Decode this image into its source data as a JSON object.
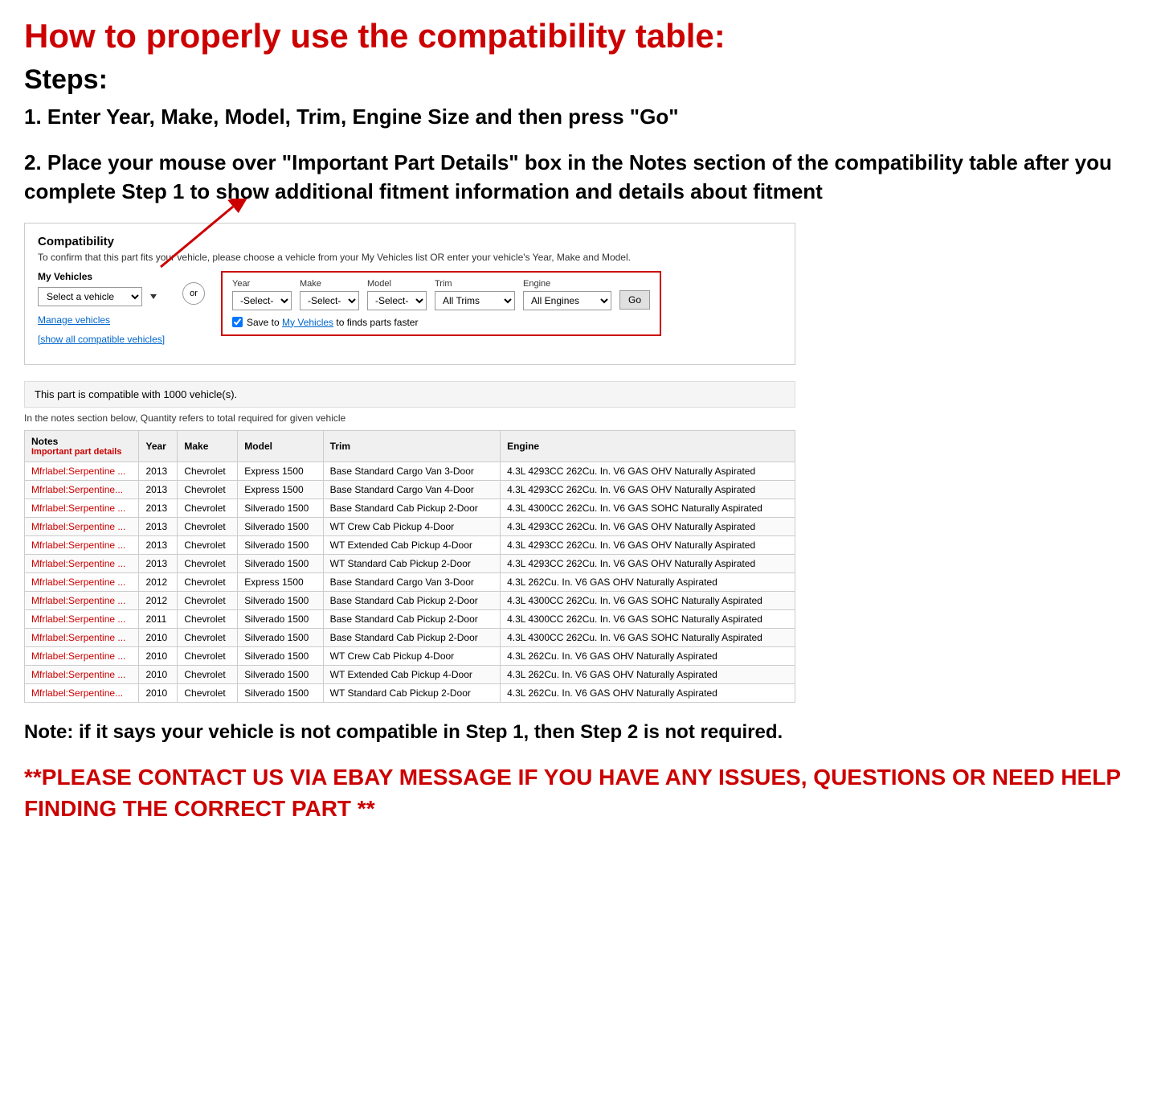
{
  "page": {
    "main_title": "How to properly use the compatibility table:",
    "steps_label": "Steps:",
    "step1": "1. Enter Year, Make, Model, Trim, Engine Size and then press \"Go\"",
    "step2": "2. Place your mouse over \"Important Part Details\" box in the Notes section of the compatibility table after you complete Step 1 to show additional fitment information and details about fitment",
    "note_text": "Note: if it says your vehicle is not compatible in Step 1, then Step 2 is not required.",
    "contact_text": "**PLEASE CONTACT US VIA EBAY MESSAGE IF YOU HAVE ANY ISSUES, QUESTIONS OR NEED HELP FINDING THE CORRECT PART **"
  },
  "compatibility_section": {
    "title": "Compatibility",
    "subtitle": "To confirm that this part fits your vehicle, please choose a vehicle from your My Vehicles list OR enter your vehicle's Year, Make and Model.",
    "my_vehicles_label": "My Vehicles",
    "select_vehicle_placeholder": "Select a vehicle",
    "or_label": "or",
    "manage_vehicles": "Manage vehicles",
    "show_all": "[show all compatible vehicles]",
    "year_label": "Year",
    "make_label": "Make",
    "model_label": "Model",
    "trim_label": "Trim",
    "engine_label": "Engine",
    "year_value": "-Select-",
    "make_value": "-Select-",
    "model_value": "-Select-",
    "trim_value": "All Trims",
    "engine_value": "All Engines",
    "go_button": "Go",
    "save_text": "Save to My Vehicles to finds parts faster",
    "compat_info": "This part is compatible with 1000 vehicle(s).",
    "compat_note": "In the notes section below, Quantity refers to total required for given vehicle",
    "table": {
      "headers": [
        "Notes",
        "Year",
        "Make",
        "Model",
        "Trim",
        "Engine"
      ],
      "notes_subheader": "Important part details",
      "rows": [
        {
          "notes": "Mfrlabel:Serpentine ...",
          "year": "2013",
          "make": "Chevrolet",
          "model": "Express 1500",
          "trim": "Base Standard Cargo Van 3-Door",
          "engine": "4.3L 4293CC 262Cu. In. V6 GAS OHV Naturally Aspirated"
        },
        {
          "notes": "Mfrlabel:Serpentine...",
          "year": "2013",
          "make": "Chevrolet",
          "model": "Express 1500",
          "trim": "Base Standard Cargo Van 4-Door",
          "engine": "4.3L 4293CC 262Cu. In. V6 GAS OHV Naturally Aspirated"
        },
        {
          "notes": "Mfrlabel:Serpentine ...",
          "year": "2013",
          "make": "Chevrolet",
          "model": "Silverado 1500",
          "trim": "Base Standard Cab Pickup 2-Door",
          "engine": "4.3L 4300CC 262Cu. In. V6 GAS SOHC Naturally Aspirated"
        },
        {
          "notes": "Mfrlabel:Serpentine ...",
          "year": "2013",
          "make": "Chevrolet",
          "model": "Silverado 1500",
          "trim": "WT Crew Cab Pickup 4-Door",
          "engine": "4.3L 4293CC 262Cu. In. V6 GAS OHV Naturally Aspirated"
        },
        {
          "notes": "Mfrlabel:Serpentine ...",
          "year": "2013",
          "make": "Chevrolet",
          "model": "Silverado 1500",
          "trim": "WT Extended Cab Pickup 4-Door",
          "engine": "4.3L 4293CC 262Cu. In. V6 GAS OHV Naturally Aspirated"
        },
        {
          "notes": "Mfrlabel:Serpentine ...",
          "year": "2013",
          "make": "Chevrolet",
          "model": "Silverado 1500",
          "trim": "WT Standard Cab Pickup 2-Door",
          "engine": "4.3L 4293CC 262Cu. In. V6 GAS OHV Naturally Aspirated"
        },
        {
          "notes": "Mfrlabel:Serpentine ...",
          "year": "2012",
          "make": "Chevrolet",
          "model": "Express 1500",
          "trim": "Base Standard Cargo Van 3-Door",
          "engine": "4.3L 262Cu. In. V6 GAS OHV Naturally Aspirated"
        },
        {
          "notes": "Mfrlabel:Serpentine ...",
          "year": "2012",
          "make": "Chevrolet",
          "model": "Silverado 1500",
          "trim": "Base Standard Cab Pickup 2-Door",
          "engine": "4.3L 4300CC 262Cu. In. V6 GAS SOHC Naturally Aspirated"
        },
        {
          "notes": "Mfrlabel:Serpentine ...",
          "year": "2011",
          "make": "Chevrolet",
          "model": "Silverado 1500",
          "trim": "Base Standard Cab Pickup 2-Door",
          "engine": "4.3L 4300CC 262Cu. In. V6 GAS SOHC Naturally Aspirated"
        },
        {
          "notes": "Mfrlabel:Serpentine ...",
          "year": "2010",
          "make": "Chevrolet",
          "model": "Silverado 1500",
          "trim": "Base Standard Cab Pickup 2-Door",
          "engine": "4.3L 4300CC 262Cu. In. V6 GAS SOHC Naturally Aspirated"
        },
        {
          "notes": "Mfrlabel:Serpentine ...",
          "year": "2010",
          "make": "Chevrolet",
          "model": "Silverado 1500",
          "trim": "WT Crew Cab Pickup 4-Door",
          "engine": "4.3L 262Cu. In. V6 GAS OHV Naturally Aspirated"
        },
        {
          "notes": "Mfrlabel:Serpentine ...",
          "year": "2010",
          "make": "Chevrolet",
          "model": "Silverado 1500",
          "trim": "WT Extended Cab Pickup 4-Door",
          "engine": "4.3L 262Cu. In. V6 GAS OHV Naturally Aspirated"
        },
        {
          "notes": "Mfrlabel:Serpentine...",
          "year": "2010",
          "make": "Chevrolet",
          "model": "Silverado 1500",
          "trim": "WT Standard Cab Pickup 2-Door",
          "engine": "4.3L 262Cu. In. V6 GAS OHV Naturally Aspirated"
        }
      ]
    }
  }
}
